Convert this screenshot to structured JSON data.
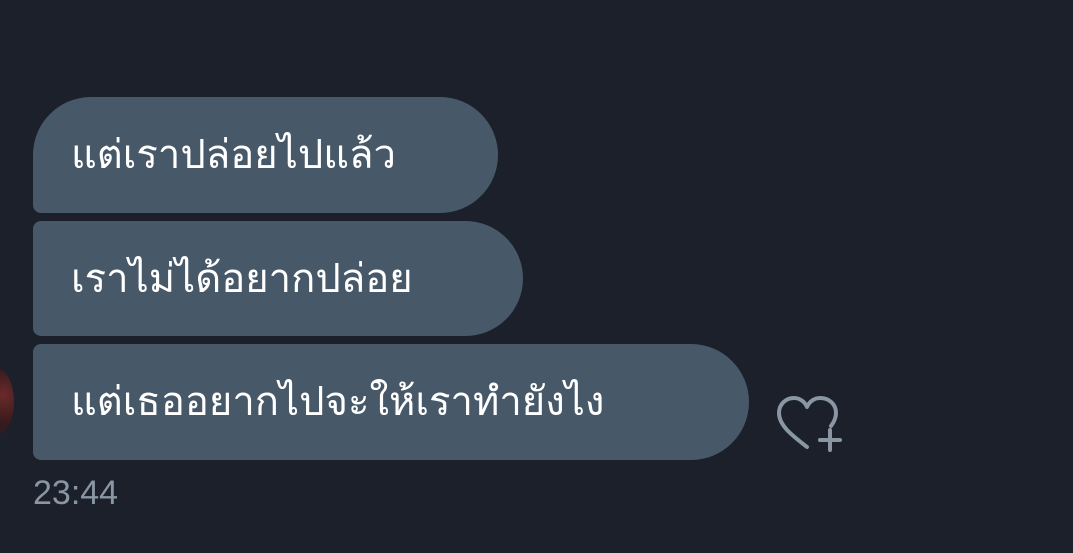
{
  "messages": [
    {
      "text": "แต่เราปล่อยไปแล้ว"
    },
    {
      "text": "เราไม่ได้อยากปล่อย"
    },
    {
      "text": "แต่เธออยากไปจะให้เราทำยังไง"
    }
  ],
  "timestamp": "23:44",
  "reaction_button": {
    "icon": "heart-plus-icon"
  },
  "colors": {
    "background": "#1b202b",
    "bubble": "#475869",
    "text": "#ffffff",
    "timestamp": "#8a96a3"
  }
}
